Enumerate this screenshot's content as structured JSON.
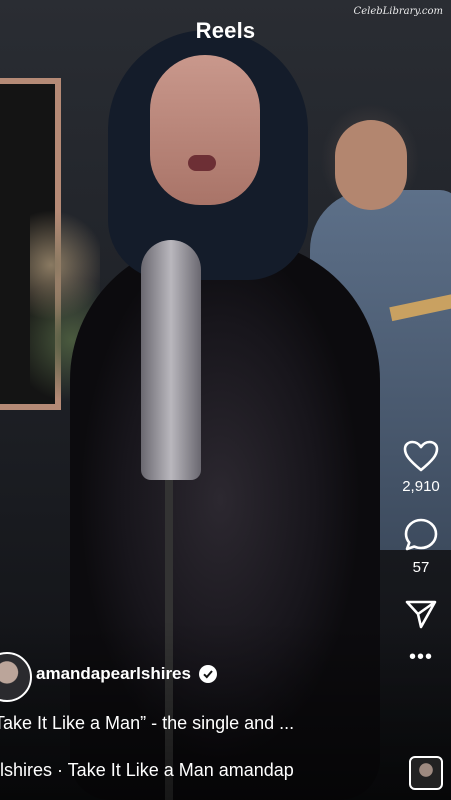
{
  "header": {
    "title": "Reels"
  },
  "watermark": "CelebLibrary.com",
  "actions": {
    "like": {
      "count": "2,910",
      "icon": "heart-icon"
    },
    "comment": {
      "count": "57",
      "icon": "comment-icon"
    },
    "share": {
      "icon": "send-icon"
    },
    "more": {
      "label": "•••",
      "icon": "more-icon"
    }
  },
  "post": {
    "username": "amandapearlshires",
    "verified": true,
    "caption": "Take It Like a Man” - the single and ...",
    "audio": "lshires · Take It Like a Man   amandap"
  },
  "colors": {
    "text": "#ffffff",
    "background": "#0d0d10"
  }
}
